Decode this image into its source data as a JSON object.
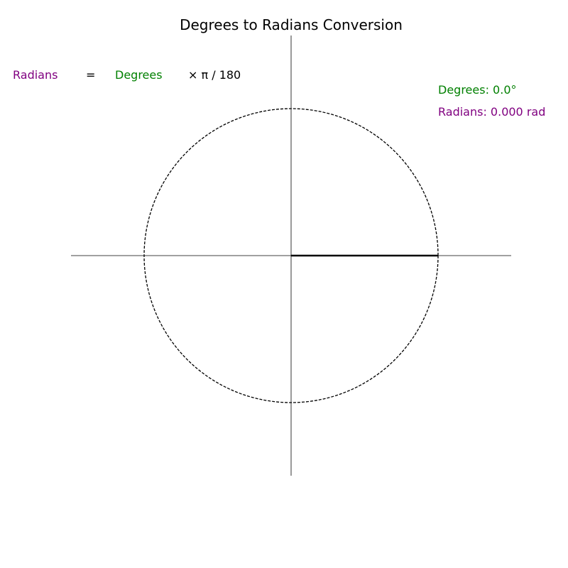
{
  "title": "Degrees to Radians Conversion",
  "formula": {
    "lhs": "Radians",
    "equals": "=",
    "term": "Degrees",
    "rhs": "×  π  /  180"
  },
  "readout": {
    "degrees_text": "Degrees: 0.0°",
    "radians_text": "Radians: 0.000 rad"
  },
  "angle_degrees": 0,
  "colors": {
    "radians": "#800080",
    "degrees": "#008000",
    "text": "#000000",
    "axes": "#000000",
    "circle": "#000000",
    "radius_line": "#000000"
  },
  "circle_style": "dashed"
}
